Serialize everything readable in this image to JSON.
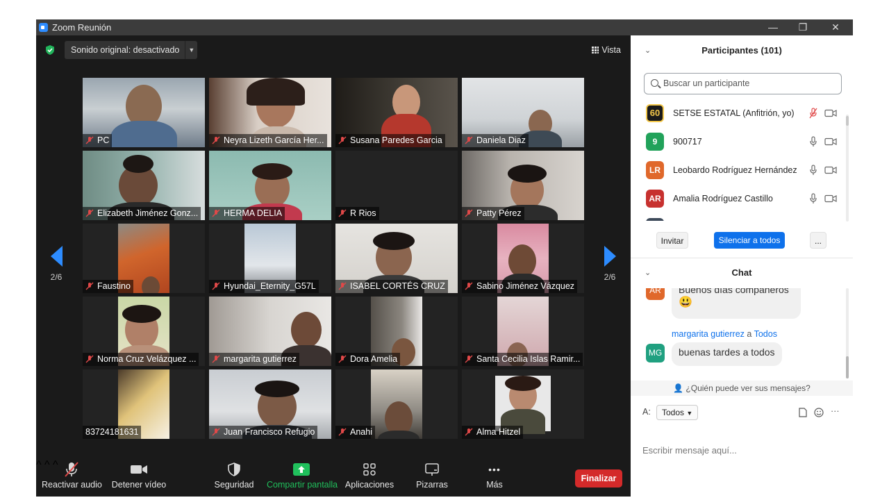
{
  "window": {
    "title": "Zoom Reunión",
    "minimize": "—",
    "restore": "❐",
    "close": "✕"
  },
  "stage": {
    "sound_label": "Sonido original: desactivado",
    "view_label": "Vista",
    "page_left": "2/6",
    "page_right": "2/6"
  },
  "tiles": [
    {
      "name": "PC"
    },
    {
      "name": "Neyra Lizeth García Her..."
    },
    {
      "name": "Susana Paredes Garcia"
    },
    {
      "name": "Daniela Diaz"
    },
    {
      "name": "Elizabeth Jiménez Gonz..."
    },
    {
      "name": "HERMA DELIA"
    },
    {
      "name": "R Rios"
    },
    {
      "name": "Patty Pérez"
    },
    {
      "name": "Faustino"
    },
    {
      "name": "Hyundai_Eternity_G57L"
    },
    {
      "name": "ISABEL CORTÉS CRUZ"
    },
    {
      "name": "Sabino Jiménez Vázquez"
    },
    {
      "name": "Norma Cruz Velázquez ..."
    },
    {
      "name": "margarita gutierrez"
    },
    {
      "name": "Dora Amelia"
    },
    {
      "name": "Santa Cecilia Islas Ramir..."
    },
    {
      "name": "83724181631"
    },
    {
      "name": "Juan Francisco Refugio"
    },
    {
      "name": "Anahi"
    },
    {
      "name": "Alma Hitzel"
    }
  ],
  "toolbar": {
    "audio": "Reactivar audio",
    "video": "Detener vídeo",
    "security": "Seguridad",
    "share": "Compartir pantalla",
    "apps": "Aplicaciones",
    "whiteboard": "Pizarras",
    "more": "Más",
    "more_glyph": "•••",
    "end": "Finalizar",
    "caret": "^"
  },
  "participants": {
    "header": "Participantes (101)",
    "search_placeholder": "Buscar un participante",
    "list": [
      {
        "avatar": "60",
        "name": "SETSE ESTATAL (Anfitrión, yo)",
        "color": "#1a1a1a"
      },
      {
        "avatar": "9",
        "name": "900717",
        "color": "#21a25a"
      },
      {
        "avatar": "LR",
        "name": "Leobardo Rodríguez Hernández",
        "color": "#e0682b"
      },
      {
        "avatar": "AR",
        "name": "Amalia Rodríguez Castillo",
        "color": "#c7312f"
      }
    ],
    "invite": "Invitar",
    "mute_all": "Silenciar a todos",
    "more": "..."
  },
  "chat": {
    "header": "Chat",
    "msg1": {
      "avatar": "AR",
      "text": "Buenos días compañeros",
      "emoji": "😃"
    },
    "msg2": {
      "sender": "margarita gutierrez",
      "connector": "a",
      "target": "Todos",
      "avatar": "MG",
      "text": "buenas tardes a todos"
    },
    "privacy": "¿Quién puede ver sus mensajes?",
    "to_label": "A:",
    "to_value": "Todos",
    "placeholder": "Escribir mensaje aquí...",
    "dots": "···"
  },
  "colors": {
    "accent": "#2d8cff",
    "share_green": "#20c05c",
    "end_red": "#d42a2a",
    "mute_red": "#e04848"
  }
}
